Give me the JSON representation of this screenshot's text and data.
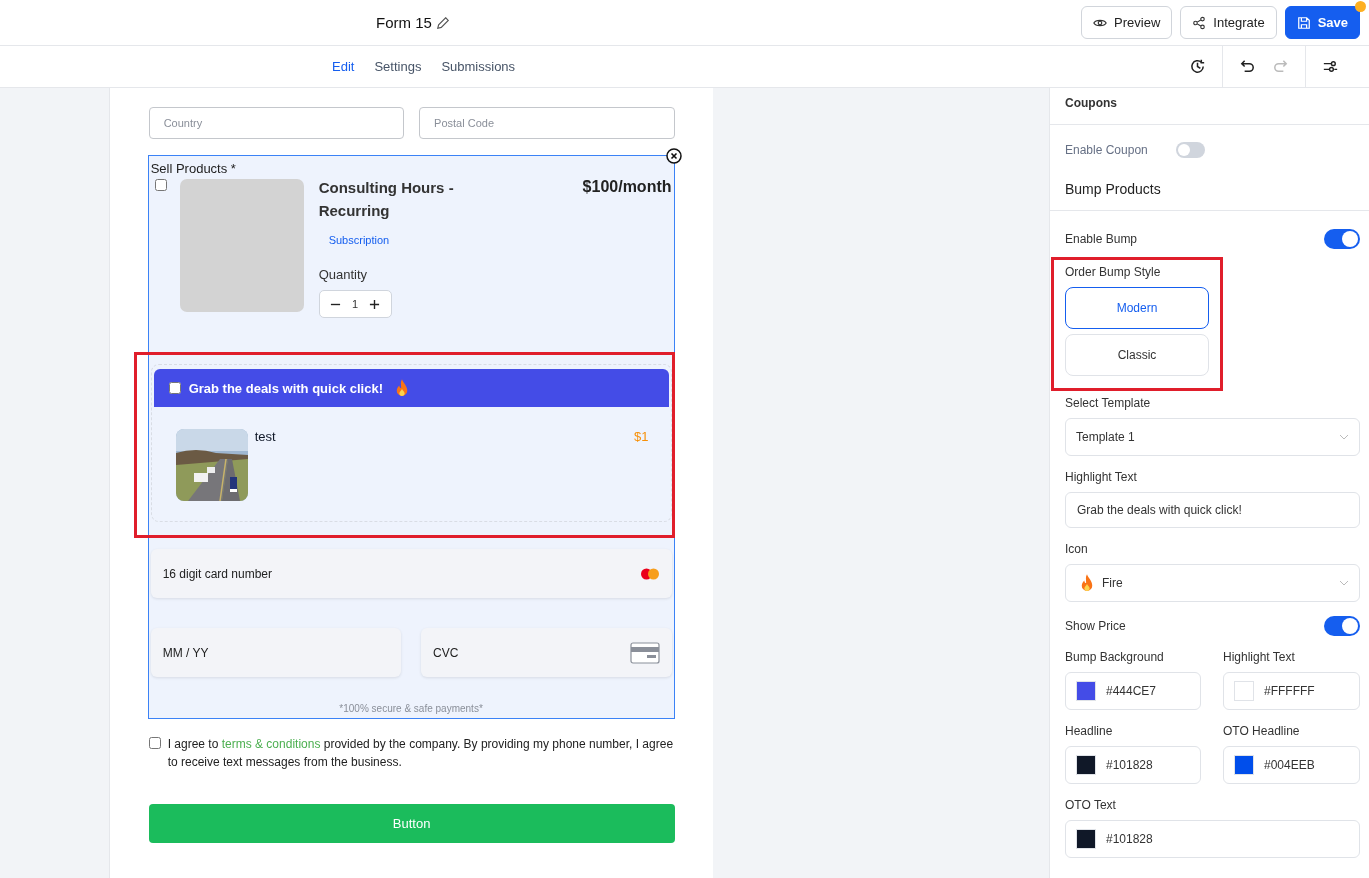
{
  "header": {
    "form_title": "Form 15",
    "buttons": [
      {
        "label": "Preview",
        "kind": "preview"
      },
      {
        "label": "Integrate",
        "kind": "integrate"
      },
      {
        "label": "Save",
        "kind": "save",
        "unsaved": true
      }
    ]
  },
  "tabs": [
    {
      "label": "Edit",
      "selected": true
    },
    {
      "label": "Settings",
      "selected": false
    },
    {
      "label": "Submissions",
      "selected": false
    }
  ],
  "toolbar": {
    "redo_disabled": true
  },
  "form": {
    "fields": [
      {
        "placeholder": "Country"
      },
      {
        "placeholder": "Postal Code"
      }
    ],
    "sell_products": {
      "label": "Sell Products *",
      "product": {
        "checked": false,
        "name": "Consulting Hours - Recurring",
        "price": "$100/month",
        "badge": "Subscription",
        "quantity_label": "Quantity",
        "quantity": "1"
      },
      "bump": {
        "checked": false,
        "headline": "Grab the deals with quick click!",
        "item": {
          "name": "test",
          "price": "$1"
        }
      },
      "card_number": {
        "placeholder": "16 digit card number"
      },
      "expiry": {
        "placeholder": "MM / YY"
      },
      "cvc": {
        "placeholder": "CVC"
      },
      "secure_note": "*100% secure & safe payments*"
    },
    "terms": {
      "checked": false,
      "text_before": "I agree to ",
      "link": "terms & conditions",
      "text_after": " provided by the company. By providing my phone number, I agree to receive text messages from the business."
    },
    "submit_button": "Button"
  },
  "panel": {
    "coupons": {
      "title": "Coupons",
      "enable_label": "Enable Coupon",
      "enabled": false
    },
    "bump": {
      "title": "Bump Products",
      "enable_label": "Enable Bump",
      "enabled": true,
      "style_label": "Order Bump Style",
      "styles": [
        {
          "label": "Modern",
          "selected": true
        },
        {
          "label": "Classic",
          "selected": false
        }
      ],
      "template_label": "Select Template",
      "template": "Template 1",
      "highlight_label": "Highlight Text",
      "highlight_value": "Grab the deals with quick click!",
      "icon_label": "Icon",
      "icon": "Fire",
      "show_price_label": "Show Price",
      "show_price": true,
      "colors": [
        {
          "label": "Bump Background",
          "value": "#444CE7"
        },
        {
          "label": "Highlight Text",
          "value": "#FFFFFF"
        },
        {
          "label": "Headline",
          "value": "#101828"
        },
        {
          "label": "OTO Headline",
          "value": "#004EEB"
        },
        {
          "label": "OTO Text",
          "value": "#101828"
        }
      ]
    }
  }
}
